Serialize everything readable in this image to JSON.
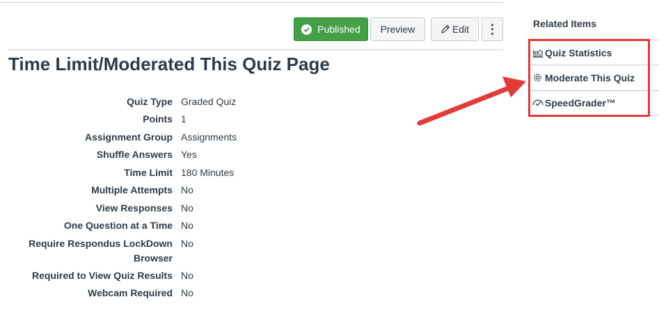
{
  "toolbar": {
    "published_label": "Published",
    "preview_label": "Preview",
    "edit_label": "Edit",
    "more_label": "⋮"
  },
  "page": {
    "title": "Time Limit/Moderated This Quiz Page"
  },
  "details": [
    {
      "label": "Quiz Type",
      "value": "Graded Quiz"
    },
    {
      "label": "Points",
      "value": "1"
    },
    {
      "label": "Assignment Group",
      "value": "Assignments"
    },
    {
      "label": "Shuffle Answers",
      "value": "Yes"
    },
    {
      "label": "Time Limit",
      "value": "180 Minutes"
    },
    {
      "label": "Multiple Attempts",
      "value": "No"
    },
    {
      "label": "View Responses",
      "value": "No"
    },
    {
      "label": "One Question at a Time",
      "value": "No"
    },
    {
      "label": "Require Respondus LockDown Browser",
      "value": "No"
    },
    {
      "label": "Required to View Quiz Results",
      "value": "No"
    },
    {
      "label": "Webcam Required",
      "value": "No"
    }
  ],
  "sidebar": {
    "title": "Related Items",
    "items": [
      {
        "label": "Quiz Statistics",
        "icon": "chart-icon"
      },
      {
        "label": "Moderate This Quiz",
        "icon": "gear-icon"
      },
      {
        "label": "SpeedGrader™",
        "icon": "speedgrader-icon"
      }
    ]
  },
  "colors": {
    "published": "#43a047",
    "annotation": "#e53935",
    "text": "#2d3b45"
  }
}
